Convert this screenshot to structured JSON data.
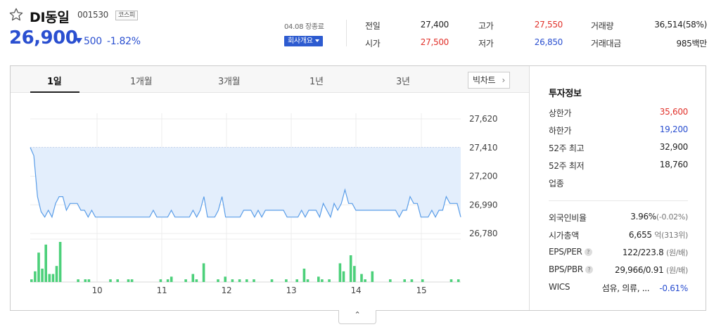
{
  "stock": {
    "name": "DI동일",
    "code": "001530",
    "market": "코스피",
    "price": "26,900",
    "change": "500",
    "change_rate": "-1.82%",
    "date_label": "04.08 장종료",
    "company_button": "회사개요"
  },
  "stats": {
    "prev_close_label": "전일",
    "prev_close": "27,400",
    "open_label": "시가",
    "open": "27,500",
    "high_label": "고가",
    "high": "27,550",
    "low_label": "저가",
    "low": "26,850",
    "volume_label": "거래량",
    "volume": "36,514(58%)",
    "amount_label": "거래대금",
    "amount": "985백만"
  },
  "tabs": [
    "1일",
    "1개월",
    "3개월",
    "1년",
    "3년"
  ],
  "bigchart_label": "빅차트",
  "info": {
    "title": "투자정보",
    "upper_limit_label": "상한가",
    "upper_limit": "35,600",
    "lower_limit_label": "하한가",
    "lower_limit": "19,200",
    "high52_label": "52주 최고",
    "high52": "32,900",
    "low52_label": "52주 최저",
    "low52": "18,760",
    "industry_label": "업종",
    "foreign_label": "외국인비율",
    "foreign_value": "3.96%",
    "foreign_change": "(-0.02%)",
    "mcap_label": "시가총액",
    "mcap_value": "6,655",
    "mcap_unit": "억(313위)",
    "eps_label": "EPS/PER",
    "eps_value": "122/223.8",
    "eps_unit": "(원/배)",
    "bps_label": "BPS/PBR",
    "bps_value": "29,966/0.91",
    "bps_unit": "(원/배)",
    "wics_label": "WICS",
    "wics_value": "섬유, 의류, ...",
    "wics_change": "-0.61%"
  },
  "colors": {
    "up": "#e1312a",
    "down": "#2a4fd0",
    "line": "#5a9de8",
    "fill": "#e3eefc",
    "volume": "#4cd07a"
  },
  "chart_data": {
    "type": "line",
    "y_ticks": [
      "27,620",
      "27,410",
      "27,200",
      "26,990",
      "26,780"
    ],
    "ylim": [
      26780,
      27620
    ],
    "x_ticks": [
      "10",
      "11",
      "12",
      "13",
      "14",
      "15"
    ],
    "prev_close": 27410,
    "price": [
      27410,
      27350,
      27050,
      26940,
      26900,
      26950,
      26900,
      27000,
      27050,
      27050,
      26950,
      27000,
      27000,
      27000,
      26950,
      26950,
      26900,
      26950,
      26900,
      26900,
      26900,
      26900,
      26900,
      26900,
      26900,
      26900,
      26900,
      26900,
      26900,
      26900,
      26900,
      26900,
      26900,
      26900,
      26950,
      26900,
      26900,
      26900,
      26900,
      26950,
      26900,
      26900,
      26900,
      26900,
      26900,
      26950,
      26900,
      26950,
      27050,
      26900,
      26900,
      26900,
      26950,
      27050,
      26900,
      26900,
      26900,
      26900,
      26900,
      26950,
      26950,
      26950,
      26900,
      26950,
      26900,
      26950,
      26950,
      26950,
      26950,
      26950,
      26950,
      26900,
      26900,
      26900,
      26900,
      26950,
      26900,
      26950,
      26950,
      26950,
      26900,
      27000,
      26950,
      26900,
      27000,
      26950,
      27000,
      27100,
      27000,
      27000,
      26950,
      26950,
      26950,
      26950,
      26950,
      26950,
      26950,
      26950,
      26950,
      26950,
      26950,
      26950,
      26900,
      26950,
      26950,
      27050,
      27000,
      27000,
      26900,
      26900,
      26900,
      26950,
      26900,
      26950,
      26950,
      27050,
      27000,
      27000,
      27000,
      26900
    ],
    "volume": [
      2,
      8,
      22,
      10,
      28,
      6,
      6,
      12,
      30,
      0,
      0,
      0,
      0,
      2,
      0,
      2,
      2,
      0,
      0,
      0,
      0,
      0,
      2,
      0,
      2,
      0,
      0,
      2,
      2,
      0,
      0,
      0,
      0,
      0,
      0,
      0,
      2,
      0,
      2,
      4,
      0,
      0,
      0,
      2,
      0,
      6,
      2,
      0,
      14,
      0,
      0,
      0,
      2,
      0,
      4,
      0,
      2,
      0,
      2,
      0,
      2,
      0,
      2,
      0,
      0,
      0,
      0,
      2,
      0,
      0,
      0,
      2,
      0,
      0,
      2,
      0,
      10,
      2,
      0,
      0,
      4,
      2,
      0,
      2,
      0,
      0,
      14,
      8,
      0,
      20,
      12,
      0,
      6,
      2,
      0,
      8,
      0,
      0,
      0,
      0,
      2,
      0,
      0,
      0,
      2,
      0,
      2,
      0,
      0,
      2,
      0,
      0,
      0,
      0,
      0,
      0,
      0,
      2,
      0,
      2
    ]
  }
}
